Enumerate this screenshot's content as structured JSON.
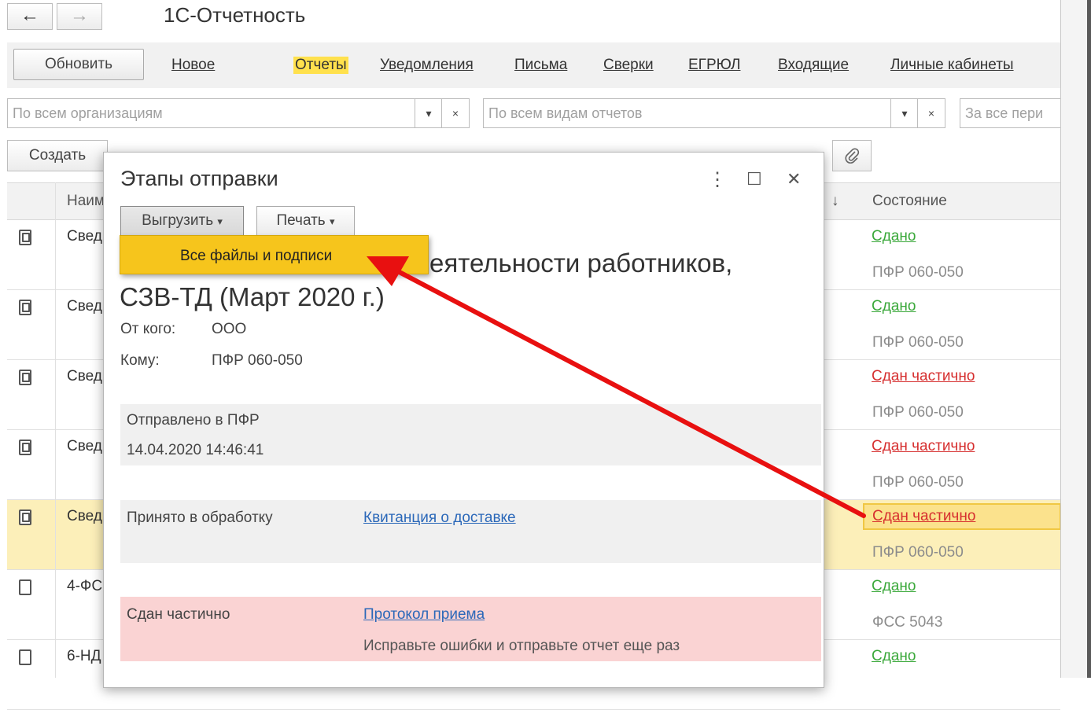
{
  "app": {
    "title": "1С-Отчетность",
    "back_icon": "←",
    "forward_icon": "→"
  },
  "commandbar": {
    "refresh_label": "Обновить",
    "links": [
      "Новое",
      "Отчеты",
      "Уведомления",
      "Письма",
      "Сверки",
      "ЕГРЮЛ",
      "Входящие",
      "Личные кабинеты"
    ],
    "active_link": "Отчеты"
  },
  "filters": {
    "org_placeholder": "По всем организациям",
    "report_type_placeholder": "По всем видам отчетов",
    "period_placeholder": "За все пери",
    "dropdown_glyph": "▾",
    "clear_glyph": "×"
  },
  "toolbar": {
    "create_label": "Создать"
  },
  "table": {
    "col_name": "Наим",
    "sort_glyph": "↓",
    "col_state": "Состояние",
    "rows": [
      {
        "name": "Свед",
        "status": "Сдано",
        "recipient": "ПФР 060-050"
      },
      {
        "name": "Свед",
        "status": "Сдано",
        "recipient": "ПФР 060-050"
      },
      {
        "name": "Свед",
        "status": "Сдан частично",
        "recipient": "ПФР 060-050"
      },
      {
        "name": "Свед",
        "status": "Сдан частично",
        "recipient": "ПФР 060-050"
      },
      {
        "name": "Свед",
        "status": "Сдан частично",
        "recipient": "ПФР 060-050"
      },
      {
        "name": "4-ФС",
        "status": "Сдано",
        "recipient": "ФСС 5043"
      },
      {
        "name": "6-НД",
        "status": "Сдано",
        "recipient": ""
      }
    ]
  },
  "dialog": {
    "title": "Этапы отправки",
    "more_glyph": "⋮",
    "maximize_glyph": "☐",
    "close_glyph": "✕",
    "export_label": "Выгрузить",
    "print_label": "Печать",
    "caret": "▾",
    "menu_item": "Все файлы и подписи",
    "report_title_line1": "еятельности работников,",
    "report_title_line2": "СЗВ-ТД (Март 2020 г.)",
    "from_label": "От кого:",
    "from_value": "ООО",
    "to_label": "Кому:",
    "to_value": "ПФР 060-050",
    "stages": {
      "sent_label": "Отправлено в ПФР",
      "sent_time": "14.04.2020 14:46:41",
      "accepted_label": "Принято в обработку",
      "accepted_link": "Квитанция о доставке",
      "partial_label": "Сдан частично",
      "partial_link": "Протокол приема",
      "partial_hint": "Исправьте ошибки и отправьте отчет еще раз"
    }
  },
  "colors": {
    "accent_yellow": "#f6c51c",
    "ok_green": "#3aa83a",
    "error_red": "#d62f2f",
    "link_blue": "#2b68b9",
    "arrow_red": "#e81010"
  }
}
